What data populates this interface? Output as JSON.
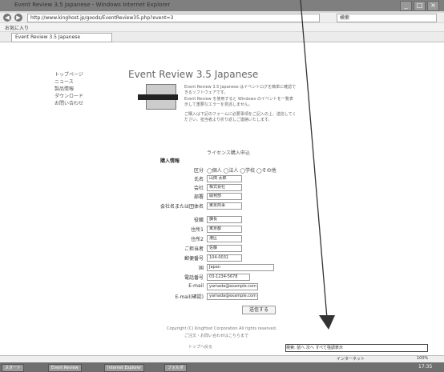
{
  "window": {
    "title": "Event Review 3.5 Japanese - Windows Internet Explorer"
  },
  "address_bar": {
    "url": "http://www.kinghost.jp/goods/EventReview35.php?event=3",
    "search_placeholder": "検索"
  },
  "favorites": {
    "label": "お気に入り"
  },
  "tab": {
    "label": "Event Review 3.5 Japanese"
  },
  "sidebar": {
    "items": [
      "トップページ",
      "ニュース",
      "製品情報",
      "ダウンロード",
      "お問い合わせ"
    ]
  },
  "page": {
    "title": "Event Review 3.5 Japanese",
    "intro1": "Event Review 3.5 Japanese はイベントログを簡単に確認できるソフトウェアです。",
    "intro2": "Event Review を使用すると Windows のイベントを一覧表示して重要なエラーを見逃しません。",
    "intro3": "ご購入は下記のフォームに必要事項をご記入の上、送信してください。担当者より折り返しご連絡いたします。",
    "form_heading": "ライセンス購入申込",
    "section_label": "購入情報",
    "submit_label": "送信する"
  },
  "form": {
    "fields": [
      {
        "label": "区分",
        "value": "◯個人 ◯法人 ◯学校 ◯その他"
      },
      {
        "label": "氏名",
        "value": "山田 太郎"
      },
      {
        "label": "会社",
        "value": "株式会社"
      },
      {
        "label": "部署",
        "value": "開発部"
      },
      {
        "label": "会社名または団体名",
        "value": "東京商事"
      },
      {
        "label": "役職",
        "value": "課長"
      },
      {
        "label": "住所1",
        "value": "東京都"
      },
      {
        "label": "住所2",
        "value": "港区"
      },
      {
        "label": "ご担当者",
        "value": "佐藤"
      },
      {
        "label": "郵便番号",
        "value": "104-0031"
      },
      {
        "label": "国",
        "value": "Japan"
      },
      {
        "label": "電話番号",
        "value": "03-1234-5678"
      },
      {
        "label": "E-mail",
        "value": "yamada@example.com"
      },
      {
        "label": "E-mail(確認)",
        "value": "yamada@example.com"
      }
    ]
  },
  "footer": {
    "line1": "Copyright (C) KingHost Corporation All rights reserved.",
    "line2": "ご注文・お問い合わせはこちらまで",
    "line3": "トップへ戻る"
  },
  "find_bar": {
    "label": "検索:",
    "buttons": "前へ 次へ すべて強調表示"
  },
  "status": {
    "left": "",
    "right": "インターネット",
    "zoom": "100%"
  },
  "taskbar": {
    "items": [
      "スタート",
      "Event Review",
      "Internet Explorer",
      "フォルダ"
    ],
    "clock": "17:35"
  }
}
